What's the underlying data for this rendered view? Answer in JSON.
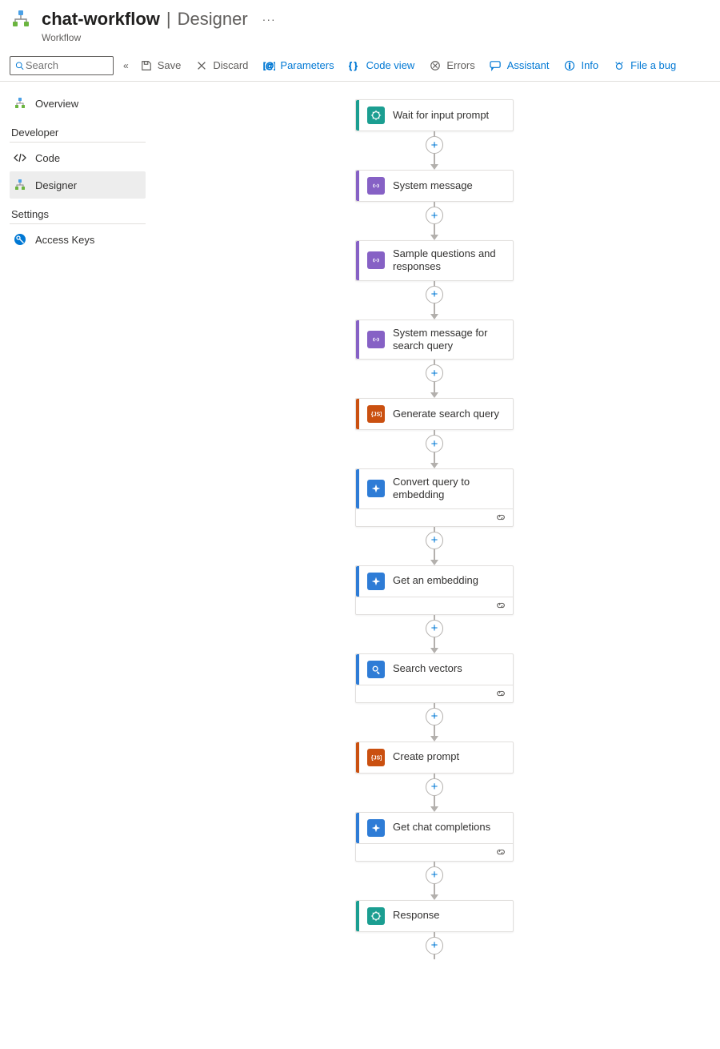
{
  "header": {
    "title": "chat-workflow",
    "separator": "|",
    "section": "Designer",
    "subtitle": "Workflow",
    "more_glyph": "···"
  },
  "search": {
    "placeholder": "Search"
  },
  "toolbar": {
    "collapse_glyph": "«",
    "save": "Save",
    "discard": "Discard",
    "parameters": "Parameters",
    "code_view": "Code view",
    "errors": "Errors",
    "assistant": "Assistant",
    "info": "Info",
    "file_bug": "File a bug"
  },
  "sidebar": {
    "overview": "Overview",
    "group_developer": "Developer",
    "code": "Code",
    "designer": "Designer",
    "group_settings": "Settings",
    "access_keys": "Access Keys"
  },
  "colors": {
    "teal": "#1b9e91",
    "purple": "#8661c5",
    "orange": "#ca5010",
    "blue": "#2e7cd6"
  },
  "nodes": [
    {
      "label": "Wait for input prompt",
      "style": "teal",
      "icon": "request",
      "footer": false
    },
    {
      "label": "System message",
      "style": "purple",
      "icon": "compose",
      "footer": false
    },
    {
      "label": "Sample questions and responses",
      "style": "purple",
      "icon": "compose",
      "footer": false
    },
    {
      "label": "System message for search query",
      "style": "purple",
      "icon": "compose",
      "footer": false
    },
    {
      "label": "Generate search query",
      "style": "orange",
      "icon": "js",
      "footer": false
    },
    {
      "label": "Convert query to embedding",
      "style": "blue",
      "icon": "sparkle",
      "footer": true
    },
    {
      "label": "Get an embedding",
      "style": "blue",
      "icon": "sparkle",
      "footer": true
    },
    {
      "label": "Search vectors",
      "style": "blue",
      "icon": "search",
      "footer": true
    },
    {
      "label": "Create prompt",
      "style": "orange",
      "icon": "js",
      "footer": false
    },
    {
      "label": "Get chat completions",
      "style": "blue",
      "icon": "sparkle",
      "footer": true
    },
    {
      "label": "Response",
      "style": "teal",
      "icon": "request",
      "footer": false
    }
  ],
  "add_glyph": "+"
}
